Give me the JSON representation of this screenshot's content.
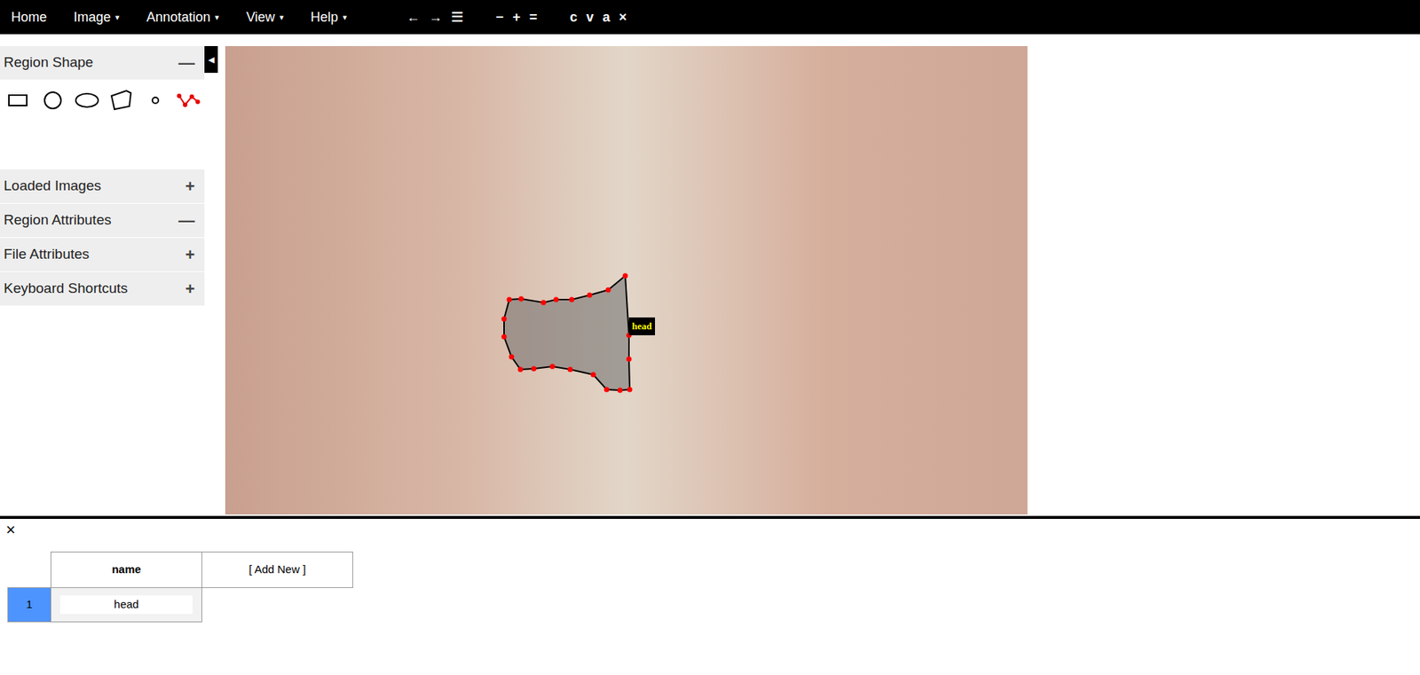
{
  "menu": [
    {
      "label": "Home",
      "arrow": ""
    },
    {
      "label": "Image",
      "arrow": "▾"
    },
    {
      "label": "Annotation",
      "arrow": "▾"
    },
    {
      "label": "View",
      "arrow": "▾"
    },
    {
      "label": "Help",
      "arrow": "▾"
    }
  ],
  "toolbar": [
    [
      "←",
      "→",
      "☰"
    ],
    [
      "−",
      "+",
      "="
    ],
    [
      "c",
      "v",
      "a",
      "×"
    ]
  ],
  "sidebar": {
    "collapse": "◀",
    "sections": [
      {
        "title": "Region Shape",
        "expanded": true,
        "toggle": "—"
      },
      {
        "title": "Loaded Images",
        "expanded": false,
        "toggle": "+"
      },
      {
        "title": "Region Attributes",
        "expanded": true,
        "toggle": "—"
      },
      {
        "title": "File Attributes",
        "expanded": false,
        "toggle": "+"
      },
      {
        "title": "Keyboard Shortcuts",
        "expanded": false,
        "toggle": "+"
      }
    ],
    "shapes": [
      {
        "kind": "rect",
        "selected": false
      },
      {
        "kind": "circle",
        "selected": false
      },
      {
        "kind": "ellipse",
        "selected": false
      },
      {
        "kind": "polygon",
        "selected": false
      },
      {
        "kind": "point",
        "selected": false
      },
      {
        "kind": "polyline",
        "selected": true
      }
    ]
  },
  "annotation": {
    "label": "head"
  },
  "attribute_editor": {
    "close": "×",
    "columns": [
      "name",
      "[ Add New ]"
    ],
    "rows": [
      {
        "index": "1",
        "name": "head",
        "selected": true
      }
    ]
  }
}
